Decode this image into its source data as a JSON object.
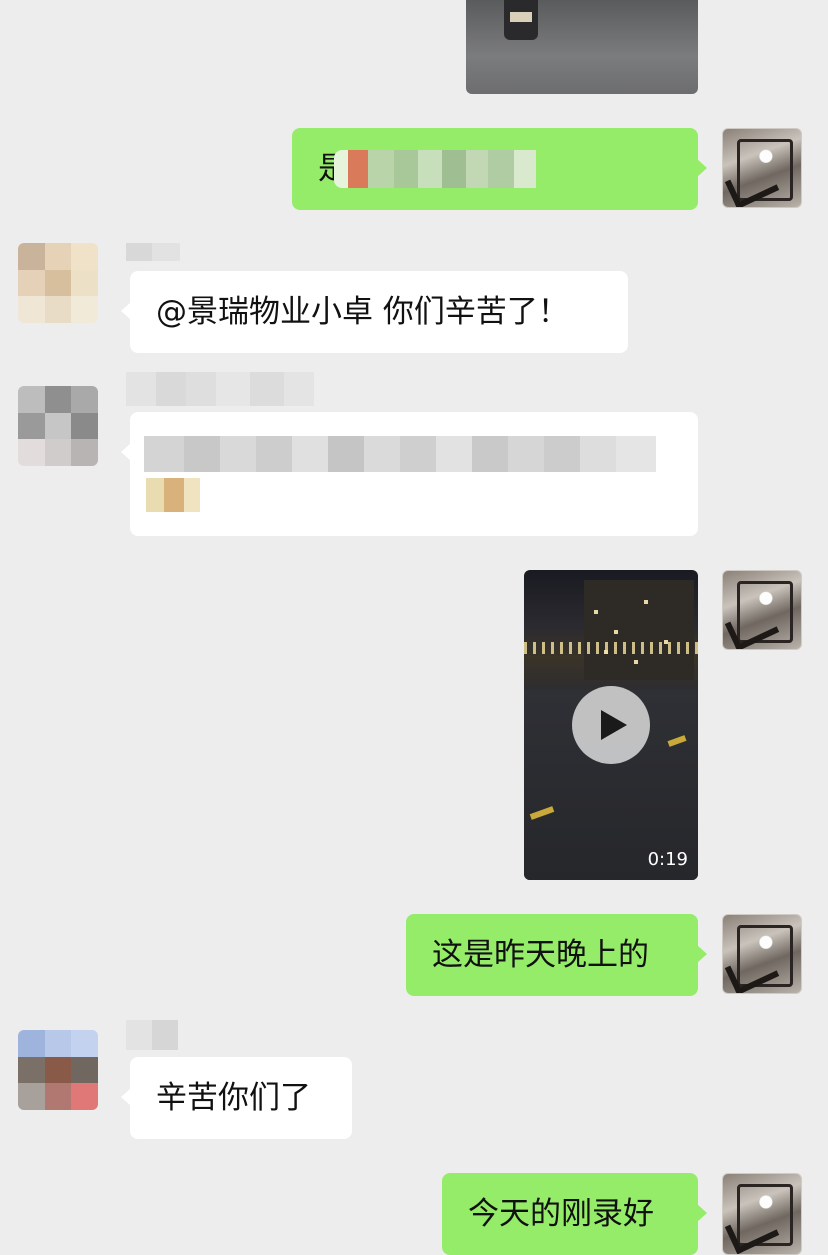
{
  "messages": [
    {
      "side": "right",
      "type": "image"
    },
    {
      "side": "right",
      "type": "text",
      "text": "是的",
      "emoji": "🔔"
    },
    {
      "side": "left",
      "type": "text",
      "text": "@景瑞物业小卓 你们辛苦了！"
    },
    {
      "side": "left",
      "type": "text-blurred"
    },
    {
      "side": "right",
      "type": "video",
      "duration": "0:19"
    },
    {
      "side": "right",
      "type": "text",
      "text": "这是昨天晚上的"
    },
    {
      "side": "left",
      "type": "text",
      "text": "辛苦你们了"
    },
    {
      "side": "right",
      "type": "text",
      "text": "今天的刚录好"
    }
  ],
  "colors": {
    "background": "#ededed",
    "outgoing_bubble": "#95ec69",
    "incoming_bubble": "#ffffff"
  }
}
